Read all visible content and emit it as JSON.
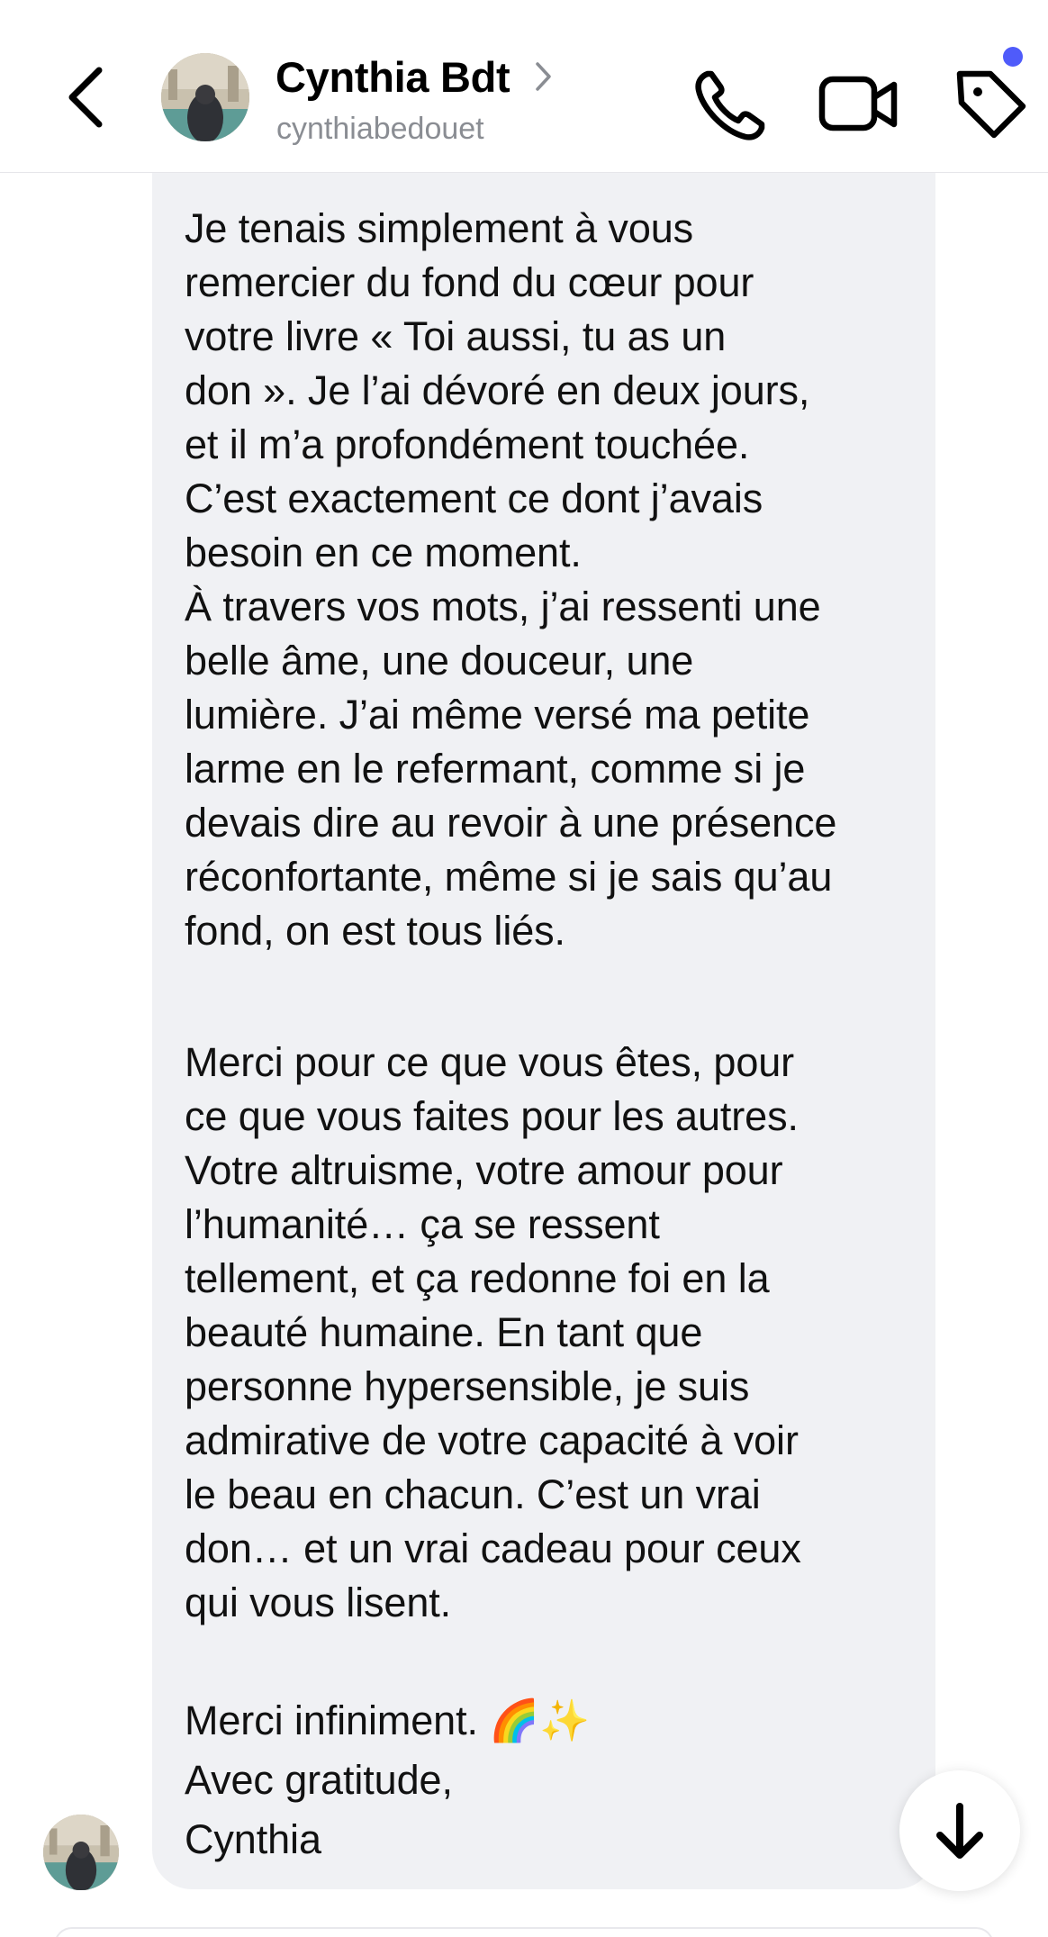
{
  "header": {
    "contact_name": "Cynthia Bdt",
    "contact_handle": "cynthiabedouet",
    "back_icon": "chevron-left-icon",
    "name_icon": "chevron-right-icon",
    "call_icon": "phone-icon",
    "video_icon": "video-camera-icon",
    "tag_icon": "tag-icon",
    "notification_color": "#4f5bfa"
  },
  "message": {
    "paragraph_1": "Je tenais simplement à vous\nremercier du fond du cœur pour\nvotre livre « Toi aussi, tu as un\ndon ». Je l’ai dévoré en deux jours,\net il m’a profondément touchée.\nC’est exactement ce dont j’avais\nbesoin en ce moment.\nÀ travers vos mots, j’ai ressenti une\nbelle âme, une douceur, une\nlumière. J’ai même versé ma petite\nlarme en le refermant, comme si je\ndevais dire au revoir à une présence\nréconfortante, même si je sais qu’au\nfond, on est tous liés.",
    "paragraph_2": "Merci pour ce que vous êtes, pour\nce que vous faites pour les autres.\nVotre altruisme, votre amour pour\nl’humanité… ça se ressent\ntellement, et ça redonne foi en la\nbeauté humaine. En tant que\npersonne hypersensible, je suis\nadmirative de votre capacité à voir\nle beau en chacun. C’est un vrai\ndon… et un vrai cadeau pour ceux\nqui vous lisent.",
    "paragraph_3": "Merci infiniment. 🌈✨\nAvec gratitude,\nCynthia",
    "bubble_color": "#f0f1f4"
  },
  "scroll_button": {
    "icon": "arrow-down-icon"
  }
}
